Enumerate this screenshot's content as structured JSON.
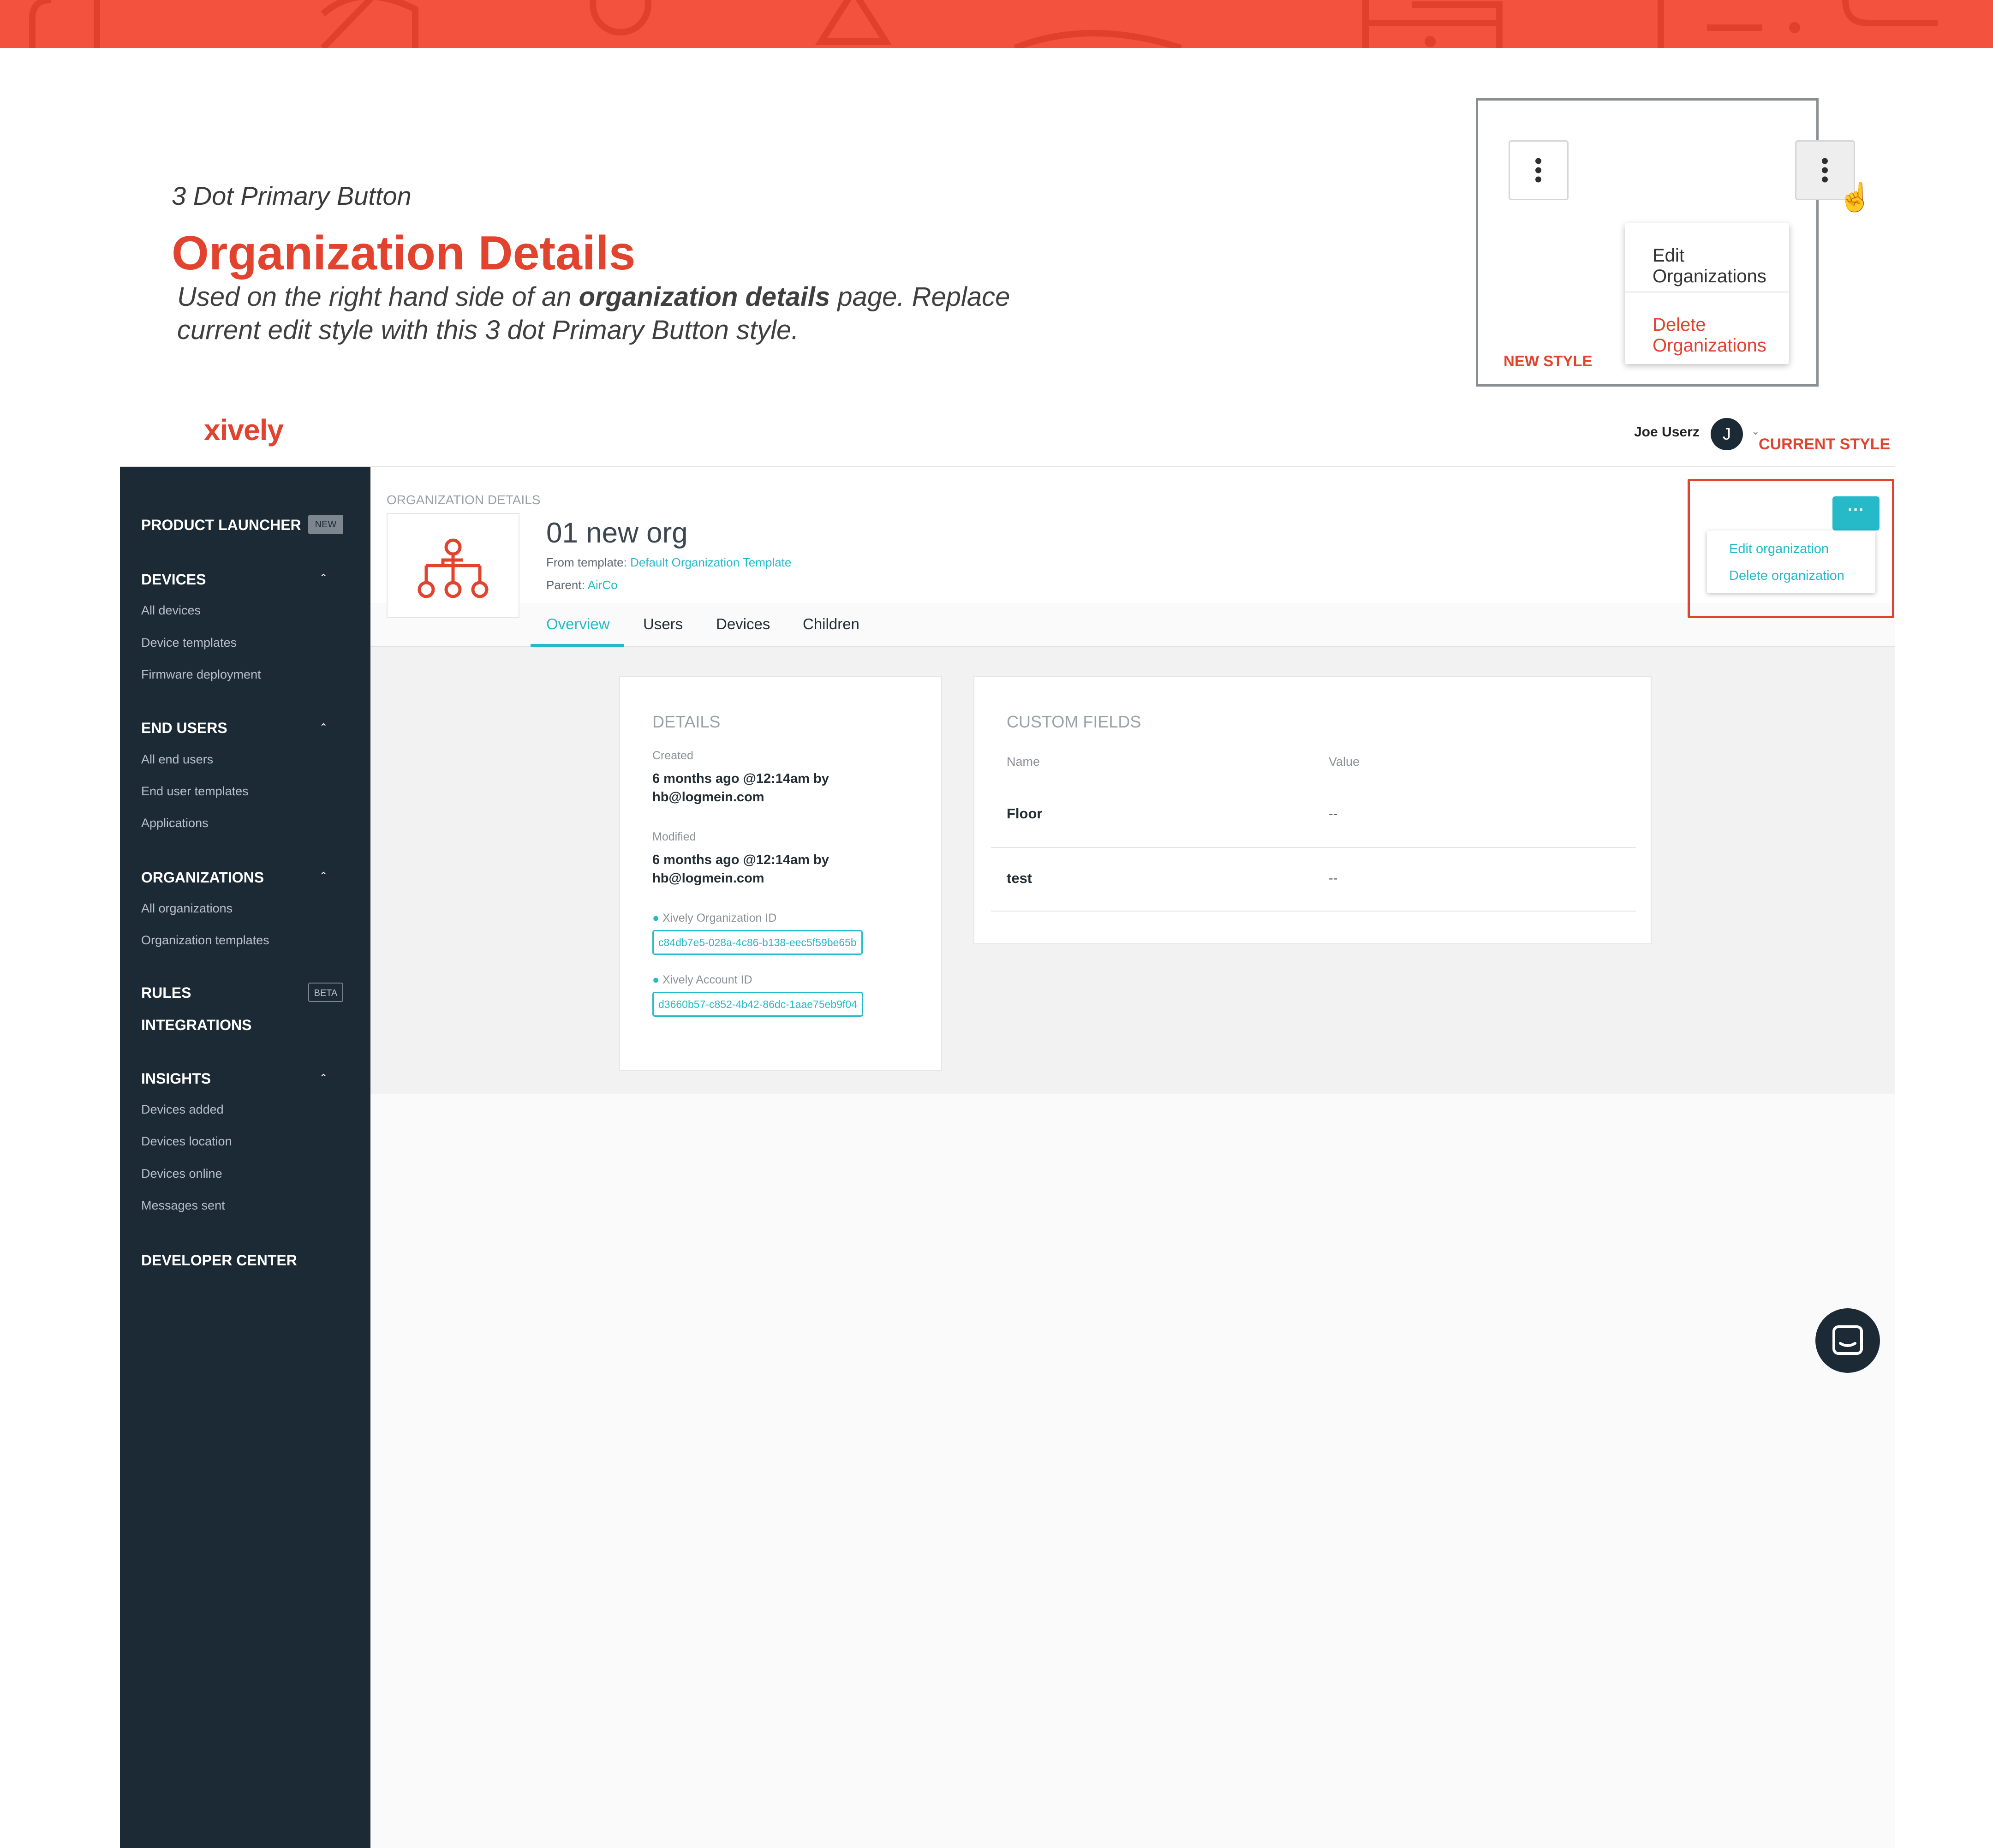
{
  "doc": {
    "subtitle": "3 Dot Primary Button",
    "title": "Organization Details",
    "description_parts": [
      "Used on the right hand side of an ",
      "organization details",
      " page. Replace current edit style with this 3 dot Primary Button style."
    ],
    "new_style_label": "NEW STYLE",
    "current_style_label": "CURRENT STYLE",
    "new_menu": {
      "edit": "Edit Organizations",
      "delete": "Delete Organizations"
    }
  },
  "header": {
    "logo": "xively",
    "user_name": "Joe Userz",
    "avatar_initial": "J"
  },
  "sidebar": {
    "product_launcher": "PRODUCT LAUNCHER",
    "badge_new": "NEW",
    "devices": {
      "title": "DEVICES",
      "items": [
        "All devices",
        "Device templates",
        "Firmware deployment"
      ]
    },
    "end_users": {
      "title": "END USERS",
      "items": [
        "All end users",
        "End user templates",
        "Applications"
      ]
    },
    "organizations": {
      "title": "ORGANIZATIONS",
      "items": [
        "All organizations",
        "Organization templates"
      ]
    },
    "rules": "RULES",
    "badge_beta": "BETA",
    "integrations": "INTEGRATIONS",
    "insights": {
      "title": "INSIGHTS",
      "items": [
        "Devices added",
        "Devices location",
        "Devices online",
        "Messages sent"
      ]
    },
    "developer_center": "DEVELOPER CENTER"
  },
  "org": {
    "section_label": "ORGANIZATION DETAILS",
    "name": "01 new org",
    "from_template_label": "From template:",
    "from_template_link": "Default Organization Template",
    "parent_label": "Parent:",
    "parent_link": "AirCo",
    "tabs": [
      "Overview",
      "Users",
      "Devices",
      "Children"
    ],
    "active_tab": "Overview",
    "kebab_label": "···",
    "menu": {
      "edit": "Edit organization",
      "delete": "Delete organization"
    }
  },
  "details": {
    "title": "DETAILS",
    "created_label": "Created",
    "created_value": "6 months ago @12:14am by hb@logmein.com",
    "modified_label": "Modified",
    "modified_value": "6 months ago @12:14am by hb@logmein.com",
    "org_id_label": "Xively Organization ID",
    "org_id_value": "c84db7e5-028a-4c86-b138-eec5f59be65b",
    "account_id_label": "Xively Account ID",
    "account_id_value": "d3660b57-c852-4b42-86dc-1aae75eb9f04"
  },
  "custom_fields": {
    "title": "CUSTOM FIELDS",
    "col_name": "Name",
    "col_value": "Value",
    "rows": [
      {
        "name": "Floor",
        "value": "--"
      },
      {
        "name": "test",
        "value": "--"
      }
    ]
  },
  "colors": {
    "accent": "#26bac8",
    "brand": "#e2432f",
    "banner": "#f2523e",
    "sidebar": "#1b2a35"
  },
  "icons": [
    "three-dot-vertical-icon",
    "hand-cursor-icon",
    "org-hierarchy-icon",
    "chevron-up-icon",
    "chevron-down-icon",
    "chat-icon"
  ]
}
